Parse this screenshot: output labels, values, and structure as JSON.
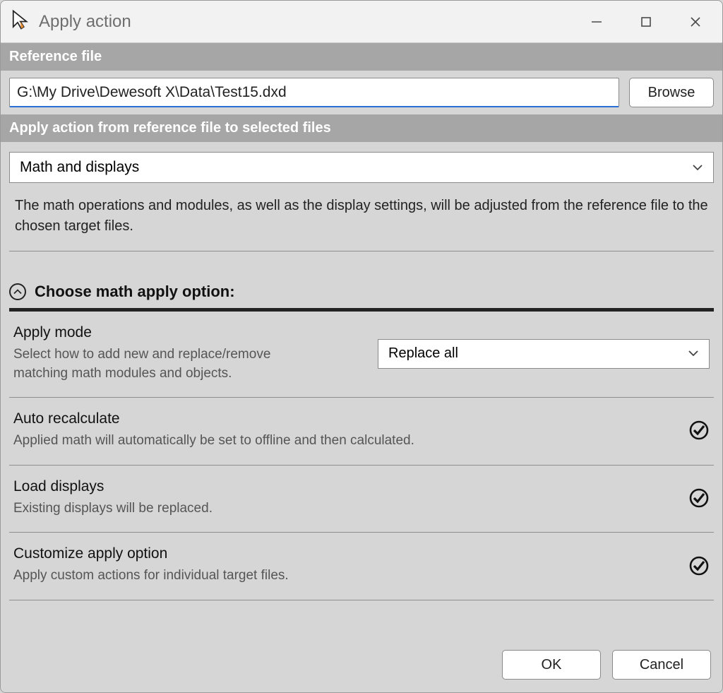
{
  "window": {
    "title": "Apply action"
  },
  "sections": {
    "reference_file": "Reference file",
    "apply_action": "Apply action from reference file to selected files"
  },
  "reference": {
    "path": "G:\\My Drive\\Dewesoft X\\Data\\Test15.dxd",
    "browse": "Browse"
  },
  "apply": {
    "dropdown_value": "Math and displays",
    "description": "The math operations and modules, as well as the display settings, will be adjusted from the reference file to the chosen target files."
  },
  "math_section": {
    "heading": "Choose math apply option:",
    "apply_mode": {
      "title": "Apply mode",
      "sub": "Select how to add new and replace/remove matching math modules and objects.",
      "value": "Replace all"
    },
    "auto_recalc": {
      "title": "Auto recalculate",
      "sub": "Applied math will automatically be set to offline and then calculated.",
      "checked": true
    },
    "load_displays": {
      "title": "Load displays",
      "sub": "Existing displays will be replaced.",
      "checked": true
    },
    "customize": {
      "title": "Customize apply option",
      "sub": "Apply custom actions for individual target files.",
      "checked": true
    }
  },
  "footer": {
    "ok": "OK",
    "cancel": "Cancel"
  }
}
